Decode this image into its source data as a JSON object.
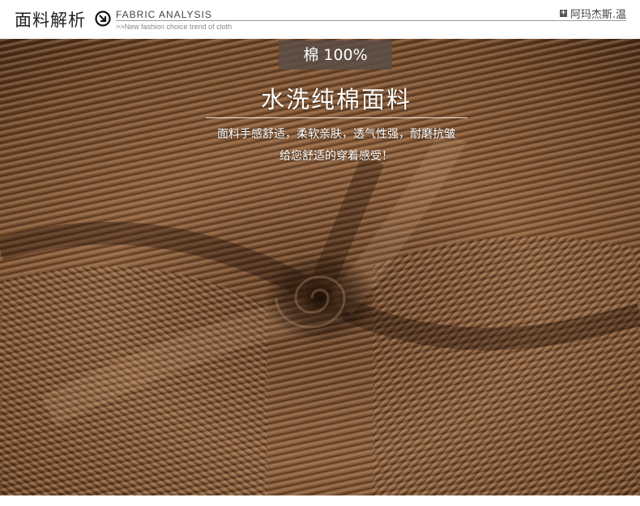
{
  "header": {
    "title_cn": "面料解析",
    "title_en": "FABRIC ANALYSIS",
    "subtitle": ">>New fashion choice  trend of cloth",
    "brand": "阿玛杰斯.温",
    "plus_icon": "plus-icon",
    "arrow_icon": "circle-arrow-down-right-icon"
  },
  "badge": {
    "label": "棉 100%"
  },
  "headline": "水洗纯棉面料",
  "description": {
    "line1": "面料手感舒适，柔软亲肤，透气性强，耐磨抗皱",
    "line2": "给您舒适的穿着感受！"
  },
  "colors": {
    "fabric_base": "#7a5030",
    "fabric_light": "#b58a66",
    "fabric_dark": "#3d2414",
    "badge_bg": "#5a4e46"
  }
}
